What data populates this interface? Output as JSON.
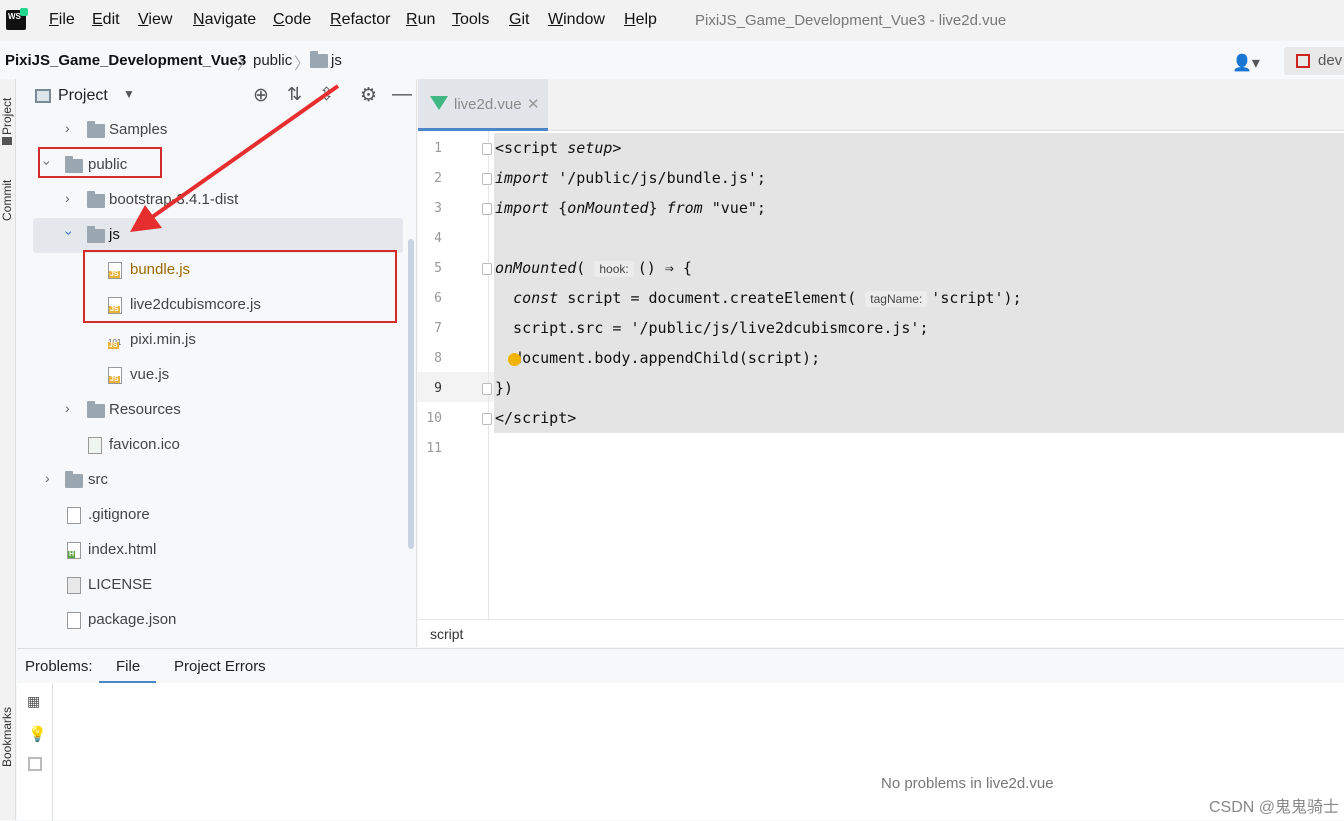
{
  "menubar": {
    "logo": "WS",
    "items": [
      "File",
      "Edit",
      "View",
      "Navigate",
      "Code",
      "Refactor",
      "Run",
      "Tools",
      "Git",
      "Window",
      "Help"
    ],
    "window_title": "PixiJS_Game_Development_Vue3 - live2d.vue"
  },
  "navbar": {
    "project": "PixiJS_Game_Development_Vue3",
    "public": "public",
    "js": "js",
    "dev_button": "dev"
  },
  "left_strip": {
    "project": "Project",
    "commit": "Commit",
    "bookmarks": "Bookmarks"
  },
  "project_panel": {
    "title": "Project",
    "tree": {
      "samples": "Samples",
      "public": "public",
      "bootstrap": "bootstrap-3.4.1-dist",
      "js": "js",
      "bundle": "bundle.js",
      "live2dcubismcore": "live2dcubismcore.js",
      "pixi": "pixi.min.js",
      "vue": "vue.js",
      "resources": "Resources",
      "favicon": "favicon.ico",
      "src": "src",
      "gitignore": ".gitignore",
      "index": "index.html",
      "license": "LICENSE",
      "package": "package.json"
    }
  },
  "editor": {
    "tab": "live2d.vue",
    "line_numbers": [
      "1",
      "2",
      "3",
      "4",
      "5",
      "6",
      "7",
      "8",
      "9",
      "10",
      "11"
    ],
    "hints": {
      "hook": "hook:",
      "tagName": "tagName:"
    },
    "status_breadcrumb": "script"
  },
  "problems": {
    "label": "Problems:",
    "tab_file": "File",
    "tab_project_errors": "Project Errors",
    "empty_message": "No problems in live2d.vue"
  },
  "watermark": "CSDN @鬼鬼骑士",
  "colors": {
    "accent": "#4a86c8",
    "annotation": "#d42b2b",
    "vue": "#41b883"
  }
}
